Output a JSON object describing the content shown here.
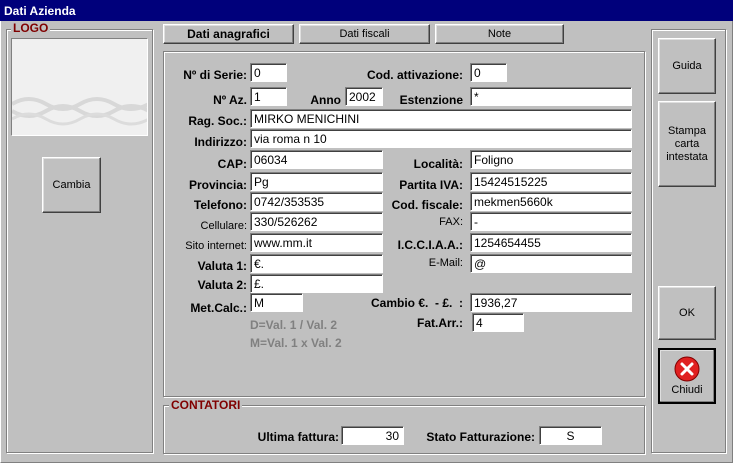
{
  "window": {
    "title": "Dati Azienda"
  },
  "logo": {
    "legend": "LOGO",
    "change_label": "Cambia"
  },
  "tabs": [
    {
      "label": "Dati anagrafici"
    },
    {
      "label": "Dati fiscali"
    },
    {
      "label": "Note"
    }
  ],
  "form": {
    "serie_label": "Nº di Serie:",
    "serie": "0",
    "attivazione_label": "Cod. attivazione:",
    "attivazione": "0",
    "naz_label": "Nº Az.",
    "naz": "1",
    "anno_label": "Anno",
    "anno": "2002",
    "estensione_label": "Estenzione",
    "estensione": "*",
    "ragsoc_label": "Rag. Soc.:",
    "ragsoc": "MIRKO MENICHINI",
    "indirizzo_label": "Indirizzo:",
    "indirizzo": "via roma n 10",
    "cap_label": "CAP:",
    "cap": "06034",
    "localita_label": "Località:",
    "localita": "Foligno",
    "provincia_label": "Provincia:",
    "provincia": "Pg",
    "piva_label": "Partita IVA:",
    "piva": "15424515225",
    "telefono_label": "Telefono:",
    "telefono": "0742/353535",
    "codfisc_label": "Cod. fiscale:",
    "codfisc": "mekmen5660k",
    "cellulare_label": "Cellulare:",
    "cellulare": "330/526262",
    "fax_label": "FAX:",
    "fax": "-",
    "sito_label": "Sito internet:",
    "sito": "www.mm.it",
    "cciaa_label": "I.C.C.I.A.A.:",
    "cciaa": "1254654455",
    "valuta1_label": "Valuta 1:",
    "valuta1": "€.",
    "email_label": "E-Mail:",
    "email": "@",
    "valuta2_label": "Valuta 2:",
    "valuta2": "£.",
    "metcalc_label": "Met.Calc.:",
    "metcalc": "M",
    "cambio_label": "Cambio €.  - £.  :",
    "cambio": "1936,27",
    "fatarr_label": "Fat.Arr.:",
    "fatarr": "4",
    "hint1": "D=Val. 1 / Val. 2",
    "hint2": "M=Val. 1 x Val. 2"
  },
  "contatori": {
    "legend": "CONTATORI",
    "ultima_label": "Ultima fattura:",
    "ultima": "30",
    "stato_label": "Stato Fatturazione:",
    "stato": "S"
  },
  "side_buttons": {
    "guida": "Guida",
    "stampa": "Stampa carta intestata",
    "ok": "OK",
    "chiudi": "Chiudi"
  },
  "colors": {
    "title_bar": "#00007b",
    "legend": "#800000",
    "close_icon": "#e02020"
  }
}
